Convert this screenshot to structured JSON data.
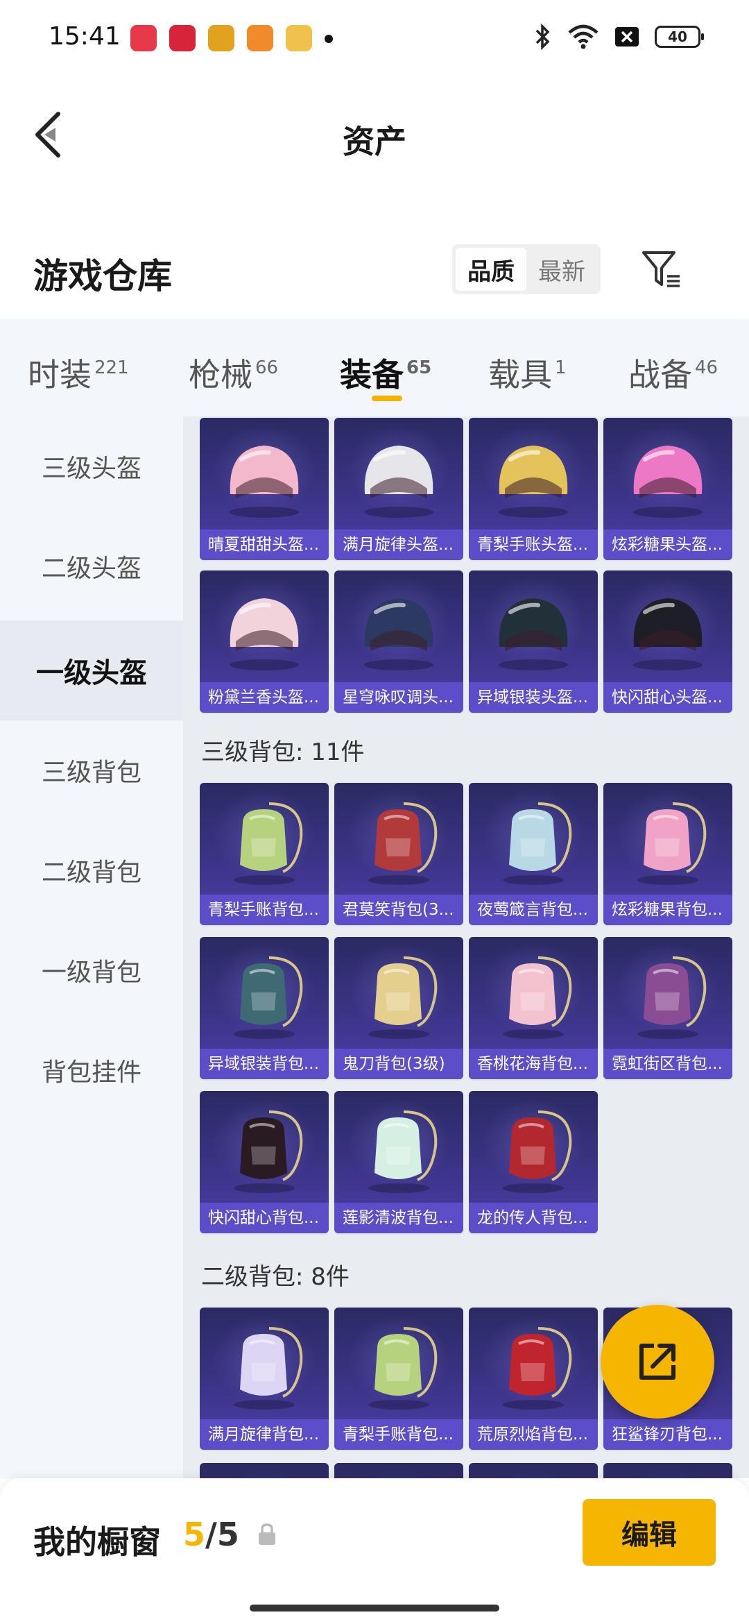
{
  "status_bar": {
    "time": "15:41",
    "battery": "40",
    "app_icon_colors": [
      "#e8394b",
      "#d8243a",
      "#e0a21f",
      "#f08a2a",
      "#f1c24a"
    ]
  },
  "header": {
    "title": "资产"
  },
  "warehouse": {
    "title": "游戏仓库",
    "sort_quality": "品质",
    "sort_newest": "最新"
  },
  "tabs": [
    {
      "label": "时装",
      "count": "221"
    },
    {
      "label": "枪械",
      "count": "66"
    },
    {
      "label": "装备",
      "count": "65"
    },
    {
      "label": "载具",
      "count": "1"
    },
    {
      "label": "战备",
      "count": "46"
    }
  ],
  "sidebar": {
    "items": [
      {
        "label": "三级头盔"
      },
      {
        "label": "二级头盔"
      },
      {
        "label": "一级头盔"
      },
      {
        "label": "三级背包"
      },
      {
        "label": "二级背包"
      },
      {
        "label": "一级背包"
      },
      {
        "label": "背包挂件"
      }
    ]
  },
  "content": {
    "helmet_cards": [
      {
        "name": "晴夏甜甜头盔...",
        "icon": "helmet-icon",
        "color": "#f3b8cc"
      },
      {
        "name": "满月旋律头盔...",
        "icon": "helmet-icon",
        "color": "#e5e5ea"
      },
      {
        "name": "青梨手账头盔...",
        "icon": "helmet-icon",
        "color": "#e3c35a"
      },
      {
        "name": "炫彩糖果头盔...",
        "icon": "helmet-icon",
        "color": "#ec78c6"
      },
      {
        "name": "粉黛兰香头盔...",
        "icon": "helmet-icon",
        "color": "#f2d3dc"
      },
      {
        "name": "星穹咏叹调头...",
        "icon": "helmet-icon",
        "color": "#2c3a63"
      },
      {
        "name": "异域银装头盔...",
        "icon": "helmet-icon",
        "color": "#22303a"
      },
      {
        "name": "快闪甜心头盔...",
        "icon": "helmet-icon",
        "color": "#1e1e26"
      }
    ],
    "section_lvl3_backpack": "三级背包: 11件",
    "lvl3_backpack_cards": [
      {
        "name": "青梨手账背包...",
        "icon": "backpack-icon",
        "color": "#b7d27e"
      },
      {
        "name": "君莫笑背包(3...",
        "icon": "backpack-icon",
        "color": "#b33a3a"
      },
      {
        "name": "夜莺箴言背包...",
        "icon": "backpack-icon",
        "color": "#b9d8e6"
      },
      {
        "name": "炫彩糖果背包...",
        "icon": "backpack-icon",
        "color": "#f0a3c4"
      },
      {
        "name": "异域银装背包...",
        "icon": "backpack-icon",
        "color": "#3e6a73"
      },
      {
        "name": "鬼刀背包(3级)",
        "icon": "backpack-icon",
        "color": "#e4cf8e"
      },
      {
        "name": "香桃花海背包...",
        "icon": "backpack-icon",
        "color": "#f3c2cf"
      },
      {
        "name": "霓虹街区背包...",
        "icon": "backpack-icon",
        "color": "#8a4d94"
      },
      {
        "name": "快闪甜心背包...",
        "icon": "backpack-icon",
        "color": "#2a1b22"
      },
      {
        "name": "莲影清波背包...",
        "icon": "backpack-icon",
        "color": "#d6efe3"
      },
      {
        "name": "龙的传人背包...",
        "icon": "backpack-icon",
        "color": "#b3282e"
      }
    ],
    "section_lvl2_backpack": "二级背包: 8件",
    "lvl2_backpack_cards": [
      {
        "name": "满月旋律背包...",
        "icon": "backpack-icon",
        "color": "#dcd5f4"
      },
      {
        "name": "青梨手账背包...",
        "icon": "backpack-icon",
        "color": "#b7d27e"
      },
      {
        "name": "荒原烈焰背包...",
        "icon": "backpack-icon",
        "color": "#c0242c"
      },
      {
        "name": "狂鲨锋刃背包...",
        "icon": "backpack-icon",
        "color": "#6b7aa8"
      }
    ]
  },
  "fab": {
    "icon": "share-icon"
  },
  "bottom_bar": {
    "title": "我的橱窗",
    "count_current": "5",
    "count_total": "/5",
    "edit_label": "编辑"
  },
  "accent_color": "#f5b500"
}
